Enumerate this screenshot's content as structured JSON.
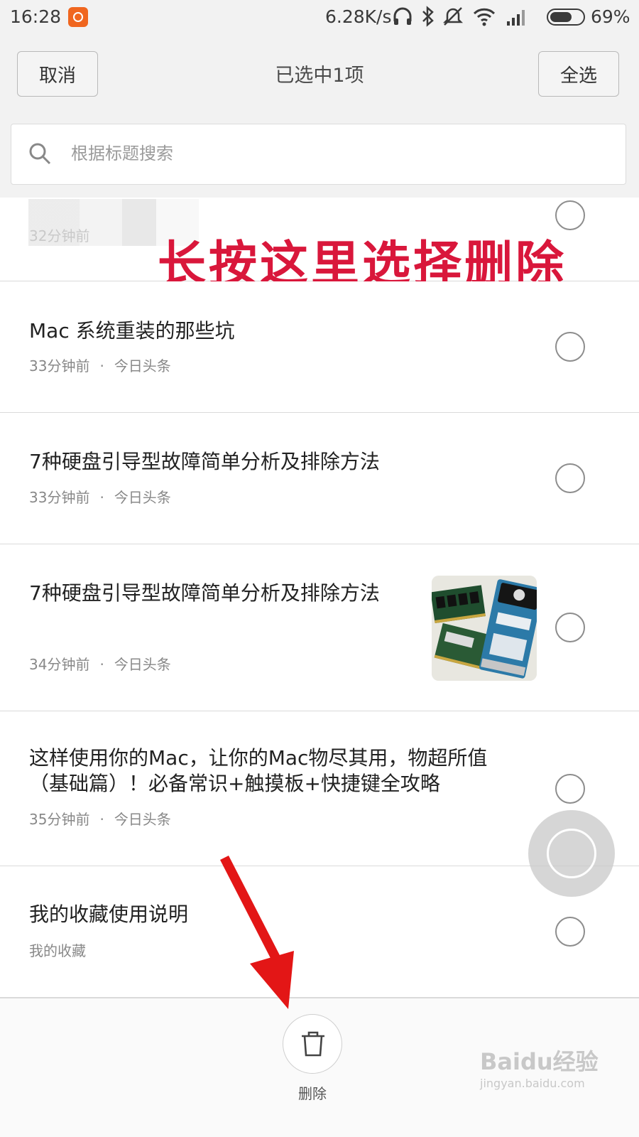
{
  "status_bar": {
    "time": "16:28",
    "net_speed": "6.28K/s",
    "battery_percent": "69%",
    "battery_level": 0.69,
    "icons": [
      "app-notification-icon",
      "headphones-icon",
      "bluetooth-icon",
      "mute-icon",
      "wifi-icon",
      "signal-icon",
      "battery-icon"
    ]
  },
  "header": {
    "cancel_label": "取消",
    "title": "已选中1项",
    "select_all_label": "全选"
  },
  "search": {
    "placeholder": "根据标题搜索"
  },
  "annotation": {
    "text": "长按这里选择删除",
    "color": "#d9173b"
  },
  "items": [
    {
      "title": "",
      "time": "32分钟前",
      "source": "",
      "partial": true
    },
    {
      "title": "Mac 系统重装的那些坑",
      "time": "33分钟前",
      "source": "今日头条"
    },
    {
      "title": "7种硬盘引导型故障简单分析及排除方法",
      "time": "33分钟前",
      "source": "今日头条"
    },
    {
      "title": "7种硬盘引导型故障简单分析及排除方法",
      "time": "34分钟前",
      "source": "今日头条",
      "has_thumbnail": true
    },
    {
      "title": "这样使用你的Mac，让你的Mac物尽其用，物超所值（基础篇）！必备常识+触摸板+快捷键全攻略",
      "time": "35分钟前",
      "source": "今日头条"
    },
    {
      "title": "我的收藏使用说明",
      "time": "",
      "source": "我的收藏"
    }
  ],
  "meta_separator": "·",
  "bottom_bar": {
    "delete_label": "删除"
  },
  "watermark": {
    "logo": "Baidu经验",
    "url": "jingyan.baidu.com"
  }
}
